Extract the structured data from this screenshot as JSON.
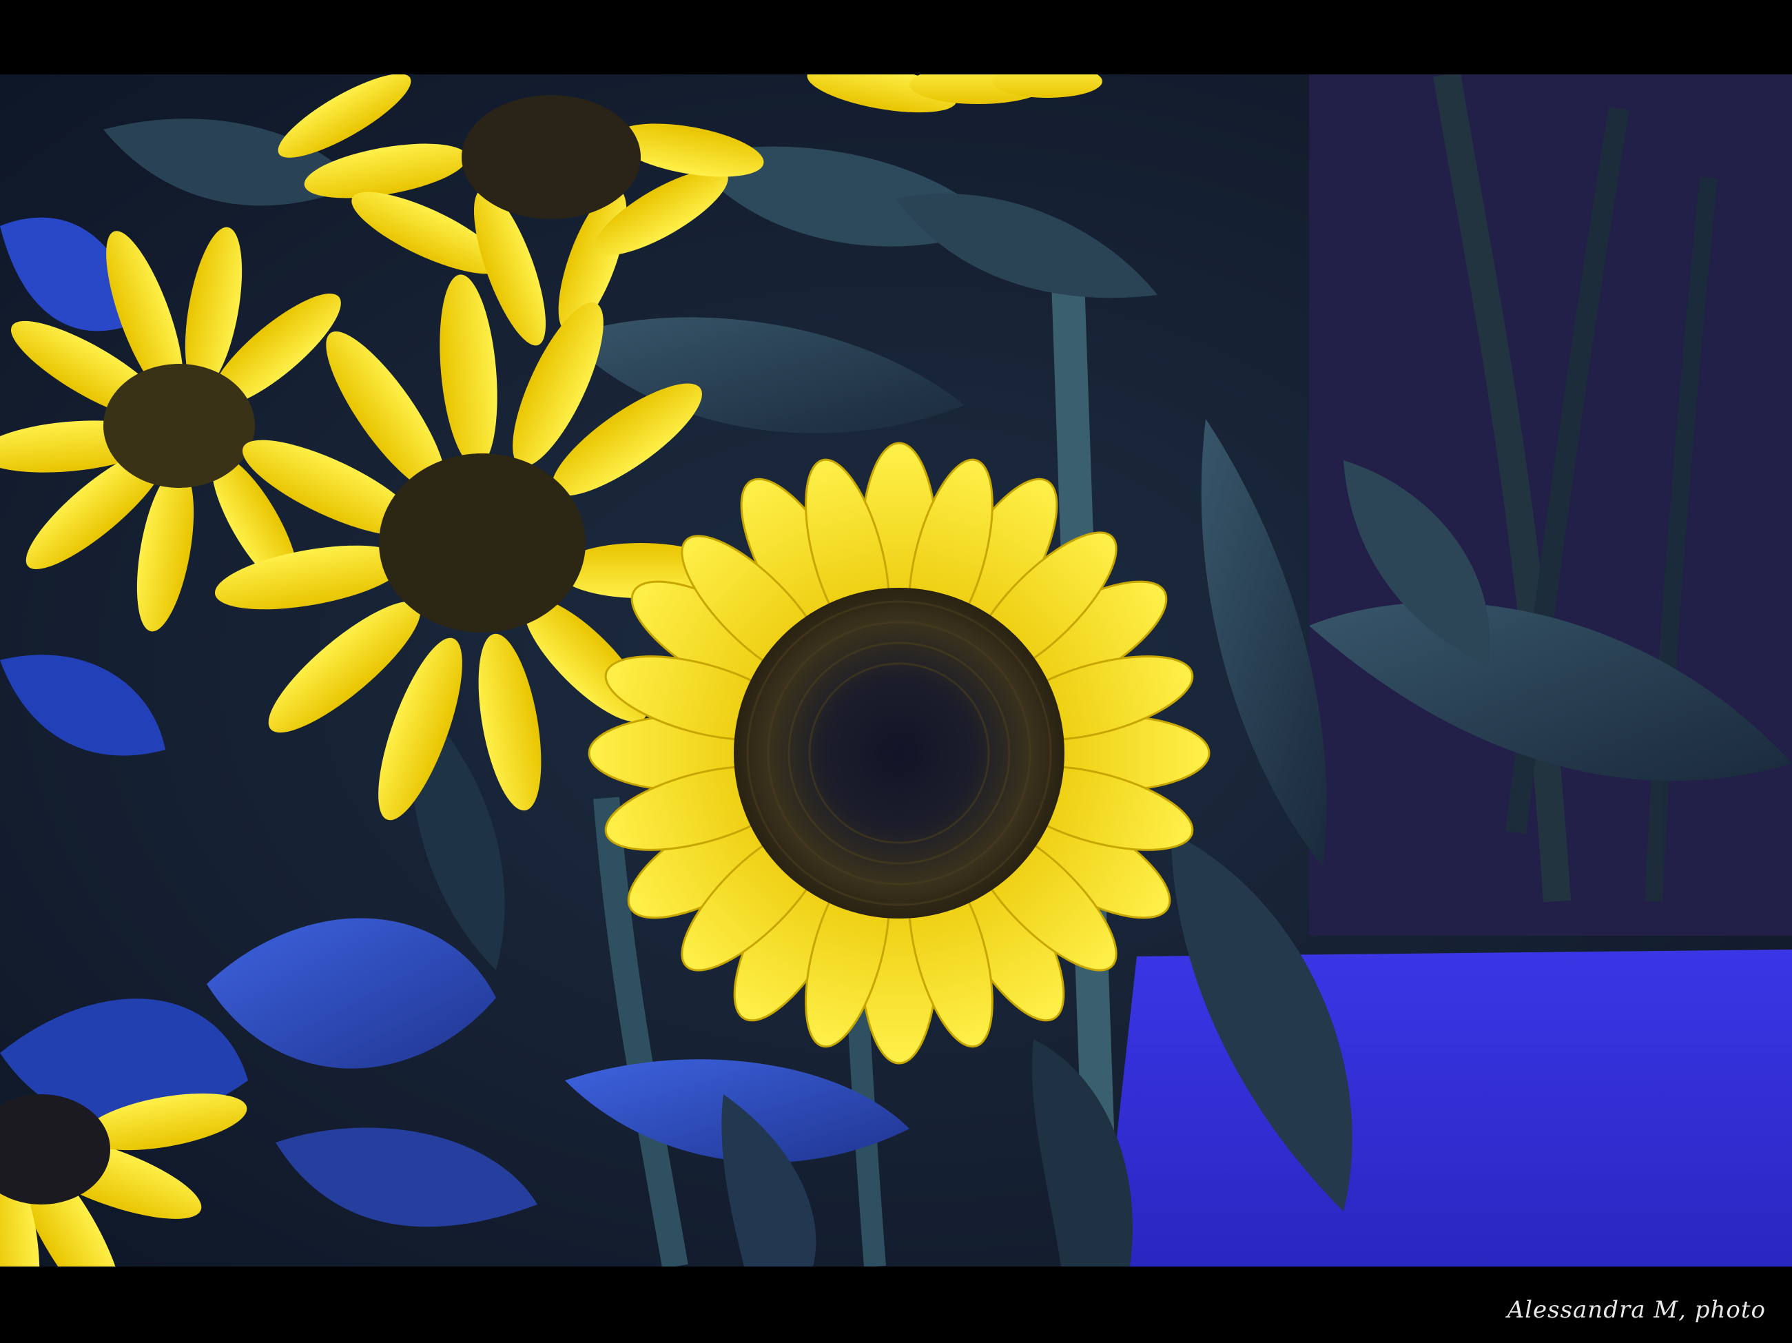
{
  "photo": {
    "subject": "sunflowers",
    "palette": {
      "background": "#000000",
      "petal": "#f4e01a",
      "petal_shadow": "#d9b800",
      "disk": "#2a2618",
      "disk_center": "#16182e",
      "leaf_dark": "#1d2e44",
      "leaf_mid": "#2f4a5e",
      "leaf_blue": "#2a4ac8",
      "wall_blue": "#3434e0"
    }
  },
  "credit": {
    "text": "Alessandra M, photo"
  }
}
